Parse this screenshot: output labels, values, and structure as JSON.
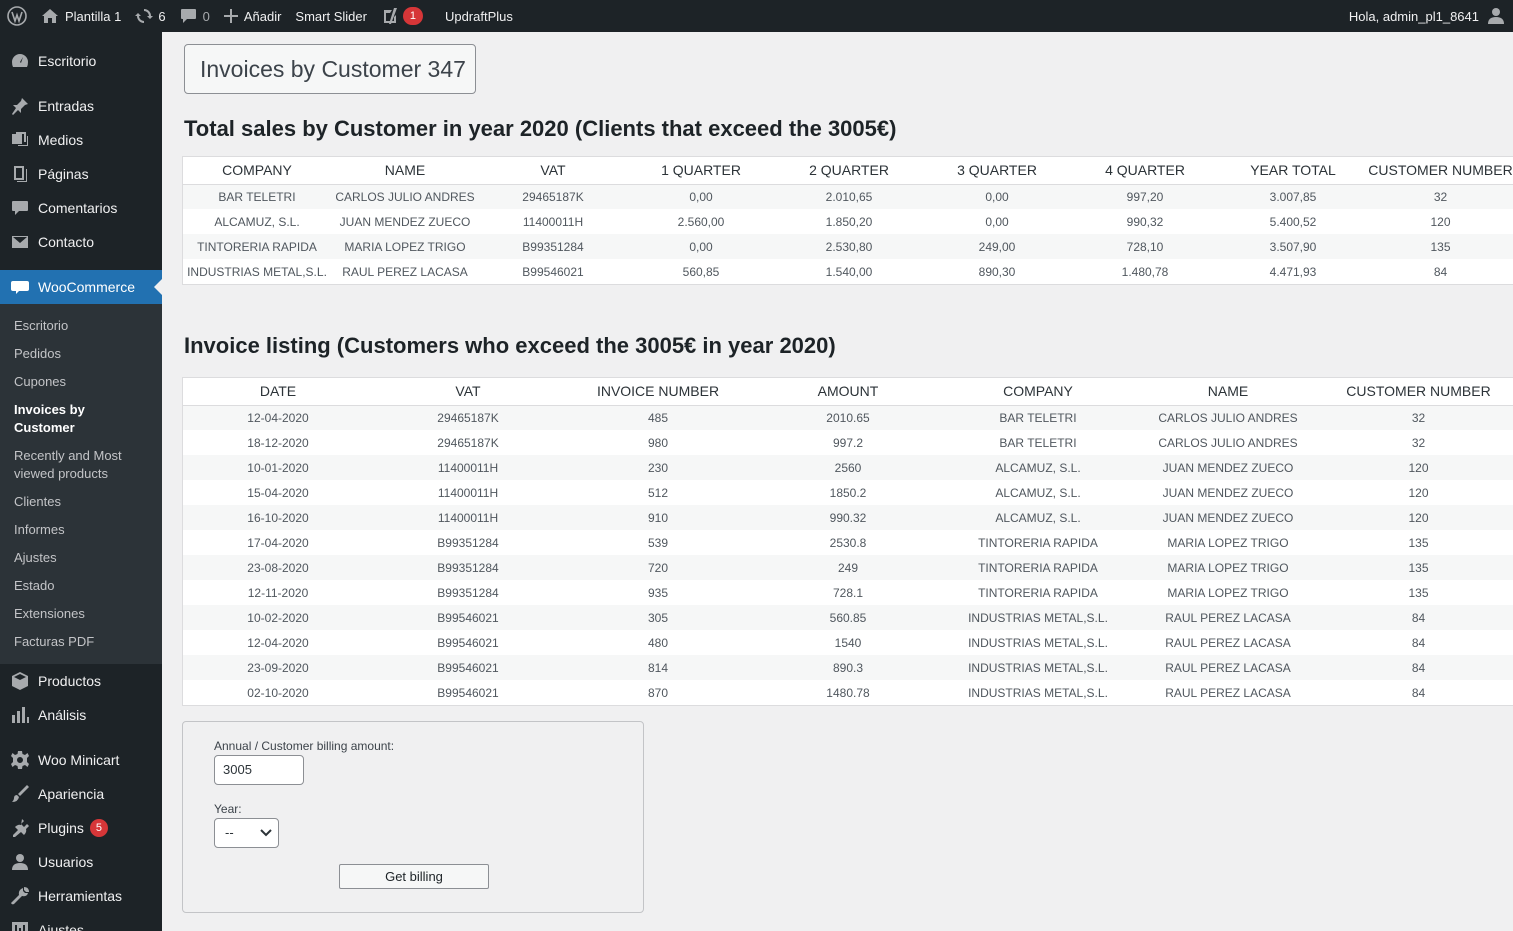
{
  "adminbar": {
    "site_name": "Plantilla 1",
    "updates_count": "6",
    "comments_count": "0",
    "new_label": "Añadir",
    "smart_slider": "Smart Slider",
    "yoast_badge": "1",
    "updraft": "UpdraftPlus",
    "greeting": "Hola, admin_pl1_8641"
  },
  "sidebar": {
    "top_items": [
      "Escritorio",
      "Entradas",
      "Medios",
      "Páginas",
      "Comentarios",
      "Contacto"
    ],
    "woocommerce": "WooCommerce",
    "submenu": [
      "Escritorio",
      "Pedidos",
      "Cupones",
      "Invoices by Customer",
      "Recently and Most viewed products",
      "Clientes",
      "Informes",
      "Ajustes",
      "Estado",
      "Extensiones",
      "Facturas PDF"
    ],
    "bottom_items": [
      "Productos",
      "Análisis",
      "Woo Minicart",
      "Apariencia",
      "Plugins",
      "Usuarios",
      "Herramientas",
      "Ajustes"
    ],
    "plugins_badge": "5"
  },
  "page": {
    "title": "Invoices by Customer 347",
    "section1_title": "Total sales by Customer in year 2020 (Clients that exceed the 3005€)",
    "section2_title": "Invoice listing (Customers who exceed the 3005€ in year 2020)"
  },
  "totals_table": {
    "headers": [
      "COMPANY",
      "NAME",
      "VAT",
      "1 QUARTER",
      "2 QUARTER",
      "3 QUARTER",
      "4 QUARTER",
      "YEAR TOTAL",
      "CUSTOMER NUMBER"
    ],
    "rows": [
      [
        "BAR TELETRI",
        "CARLOS JULIO ANDRES",
        "29465187K",
        "0,00",
        "2.010,65",
        "0,00",
        "997,20",
        "3.007,85",
        "32"
      ],
      [
        "ALCAMUZ, S.L.",
        "JUAN MENDEZ ZUECO",
        "11400011H",
        "2.560,00",
        "1.850,20",
        "0,00",
        "990,32",
        "5.400,52",
        "120"
      ],
      [
        "TINTORERIA RAPIDA",
        "MARIA LOPEZ TRIGO",
        "B99351284",
        "0,00",
        "2.530,80",
        "249,00",
        "728,10",
        "3.507,90",
        "135"
      ],
      [
        "INDUSTRIAS METAL,S.L.",
        "RAUL PEREZ LACASA",
        "B99546021",
        "560,85",
        "1.540,00",
        "890,30",
        "1.480,78",
        "4.471,93",
        "84"
      ]
    ]
  },
  "invoice_table": {
    "headers": [
      "DATE",
      "VAT",
      "INVOICE NUMBER",
      "AMOUNT",
      "COMPANY",
      "NAME",
      "CUSTOMER NUMBER"
    ],
    "rows": [
      [
        "12-04-2020",
        "29465187K",
        "485",
        "2010.65",
        "BAR TELETRI",
        "CARLOS JULIO ANDRES",
        "32"
      ],
      [
        "18-12-2020",
        "29465187K",
        "980",
        "997.2",
        "BAR TELETRI",
        "CARLOS JULIO ANDRES",
        "32"
      ],
      [
        "10-01-2020",
        "11400011H",
        "230",
        "2560",
        "ALCAMUZ, S.L.",
        "JUAN MENDEZ ZUECO",
        "120"
      ],
      [
        "15-04-2020",
        "11400011H",
        "512",
        "1850.2",
        "ALCAMUZ, S.L.",
        "JUAN MENDEZ ZUECO",
        "120"
      ],
      [
        "16-10-2020",
        "11400011H",
        "910",
        "990.32",
        "ALCAMUZ, S.L.",
        "JUAN MENDEZ ZUECO",
        "120"
      ],
      [
        "17-04-2020",
        "B99351284",
        "539",
        "2530.8",
        "TINTORERIA RAPIDA",
        "MARIA LOPEZ TRIGO",
        "135"
      ],
      [
        "23-08-2020",
        "B99351284",
        "720",
        "249",
        "TINTORERIA RAPIDA",
        "MARIA LOPEZ TRIGO",
        "135"
      ],
      [
        "12-11-2020",
        "B99351284",
        "935",
        "728.1",
        "TINTORERIA RAPIDA",
        "MARIA LOPEZ TRIGO",
        "135"
      ],
      [
        "10-02-2020",
        "B99546021",
        "305",
        "560.85",
        "INDUSTRIAS METAL,S.L.",
        "RAUL PEREZ LACASA",
        "84"
      ],
      [
        "12-04-2020",
        "B99546021",
        "480",
        "1540",
        "INDUSTRIAS METAL,S.L.",
        "RAUL PEREZ LACASA",
        "84"
      ],
      [
        "23-09-2020",
        "B99546021",
        "814",
        "890.3",
        "INDUSTRIAS METAL,S.L.",
        "RAUL PEREZ LACASA",
        "84"
      ],
      [
        "02-10-2020",
        "B99546021",
        "870",
        "1480.78",
        "INDUSTRIAS METAL,S.L.",
        "RAUL PEREZ LACASA",
        "84"
      ]
    ]
  },
  "form": {
    "amount_label": "Annual / Customer billing amount:",
    "amount_value": "3005",
    "year_label": "Year:",
    "year_value": "--",
    "submit_label": "Get billing"
  }
}
